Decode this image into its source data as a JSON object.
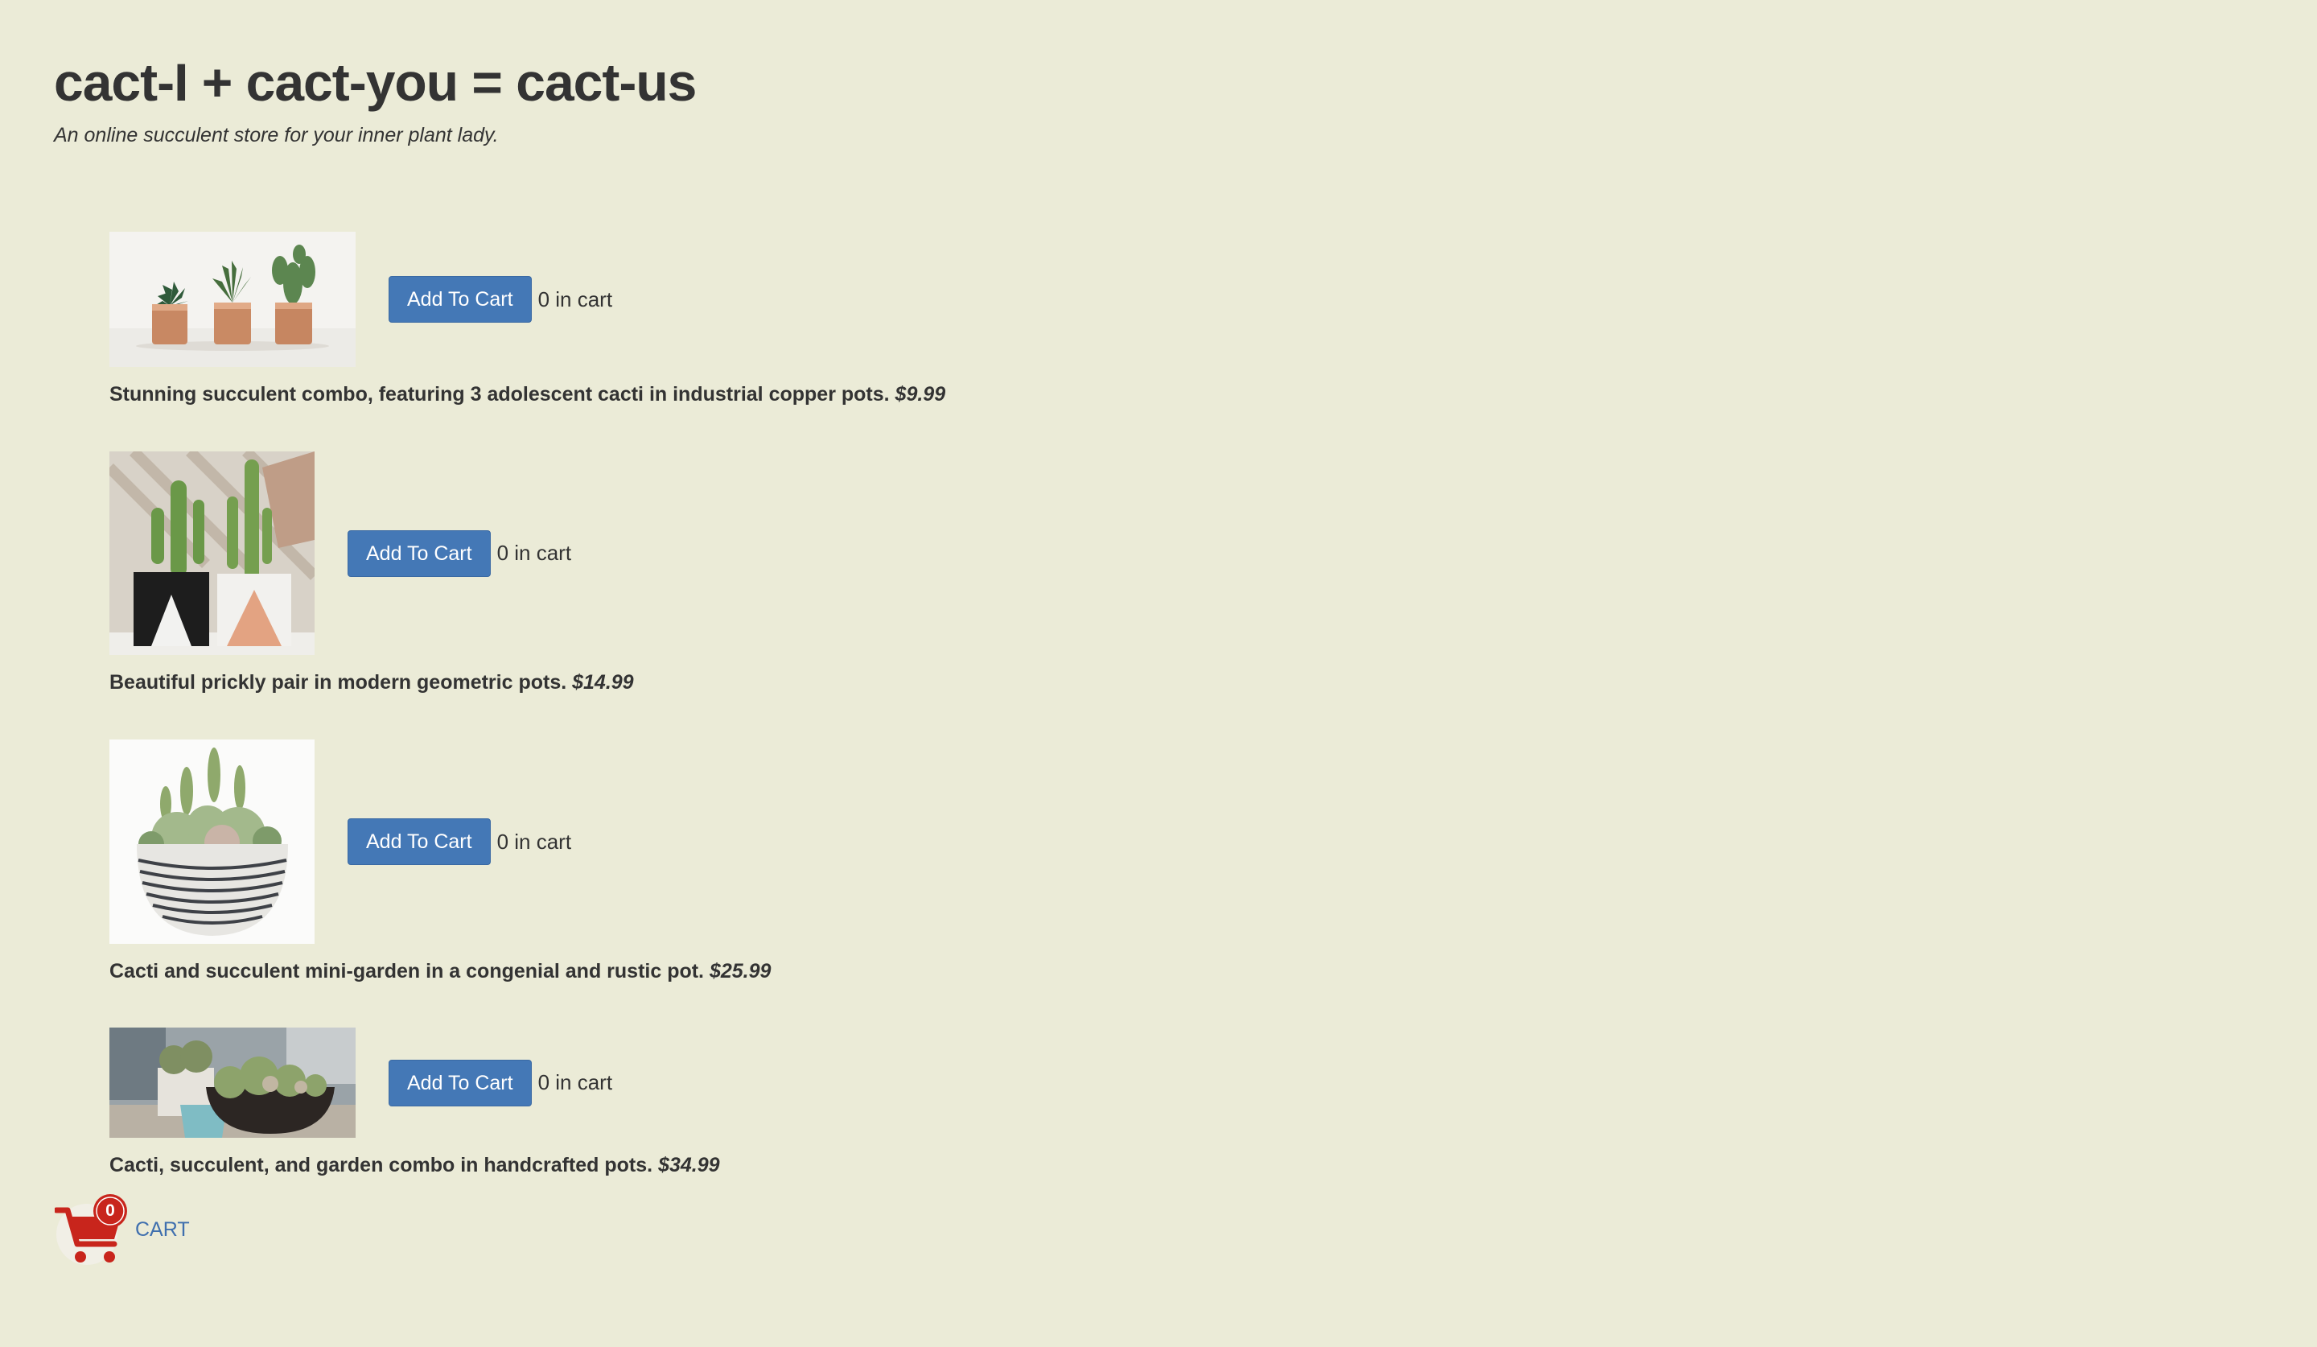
{
  "header": {
    "title": "cact-I + cact-you = cact-us",
    "tagline": "An online succulent store for your inner plant lady."
  },
  "products": [
    {
      "image_icon": "copper-pots-trio-image",
      "button_label": "Add To Cart",
      "in_cart": "0 in cart",
      "description": "Stunning succulent combo, featuring 3 adolescent cacti in industrial copper pots.",
      "price": "$9.99"
    },
    {
      "image_icon": "geometric-pots-pair-image",
      "button_label": "Add To Cart",
      "in_cart": "0 in cart",
      "description": "Beautiful prickly pair in modern geometric pots.",
      "price": "$14.99"
    },
    {
      "image_icon": "mini-garden-bowl-image",
      "button_label": "Add To Cart",
      "in_cart": "0 in cart",
      "description": "Cacti and succulent mini-garden in a congenial and rustic pot.",
      "price": "$25.99"
    },
    {
      "image_icon": "handcrafted-pots-combo-image",
      "button_label": "Add To Cart",
      "in_cart": "0 in cart",
      "description": "Cacti, succulent, and garden combo in handcrafted pots.",
      "price": "$34.99"
    }
  ],
  "cart": {
    "count": "0",
    "label": "CART",
    "icon": "shopping-cart-icon"
  },
  "colors": {
    "background": "#ebebd7",
    "button": "#4478b6",
    "cart_icon": "#c8251c",
    "link": "#3f6fae",
    "text": "#333333"
  }
}
